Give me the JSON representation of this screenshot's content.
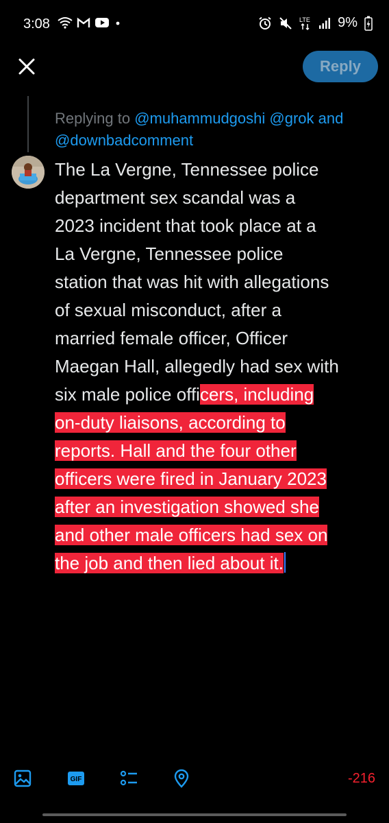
{
  "status_bar": {
    "time": "3:08",
    "battery": "9%",
    "network": "LTE",
    "icons_left": [
      "wifi-icon",
      "gmail-icon",
      "youtube-icon",
      "dot-icon"
    ],
    "icons_right": [
      "alarm-icon",
      "mute-icon",
      "lte-icon",
      "signal-icon",
      "battery-charging-icon"
    ]
  },
  "header": {
    "close_icon": "close-icon",
    "reply_label": "Reply"
  },
  "replying": {
    "prefix": "Replying to ",
    "mention1": "@muhammudgoshi",
    "mention2": "@grok",
    "and_word": " and",
    "mention3": "@downbadcomment"
  },
  "tweet": {
    "lines": [
      {
        "plain": "The La Vergne, Tennessee police",
        "selected": ""
      },
      {
        "plain": "department sex scandal was a",
        "selected": ""
      },
      {
        "plain": "2023 incident that took place at a",
        "selected": ""
      },
      {
        "plain": "La Vergne, Tennessee police",
        "selected": ""
      },
      {
        "plain": "station that was hit with allegations",
        "selected": ""
      },
      {
        "plain": "of sexual misconduct, after a",
        "selected": ""
      },
      {
        "plain": "married female officer, Officer",
        "selected": ""
      },
      {
        "plain": "Maegan Hall, allegedly had sex with",
        "selected": ""
      },
      {
        "plain": "six male police offi",
        "selected": "cers, including"
      },
      {
        "plain": "",
        "selected": "on-duty liaisons, according to"
      },
      {
        "plain": "",
        "selected": "reports. Hall and the four other"
      },
      {
        "plain": "",
        "selected": "officers were fired in January 2023"
      },
      {
        "plain": "",
        "selected": "after an investigation showed she"
      },
      {
        "plain": "",
        "selected": "and other male officers had sex on"
      },
      {
        "plain": "",
        "selected": "the job and then lied about it."
      }
    ]
  },
  "toolbar": {
    "icons": [
      "image-icon",
      "gif-icon",
      "poll-icon",
      "location-icon"
    ],
    "gif_label": "GIF",
    "char_count": "-216"
  },
  "colors": {
    "accent": "#1d9bf0",
    "reply_button": "#1d6aa3",
    "selection": "#f0253a",
    "over_limit": "#f4212e"
  }
}
